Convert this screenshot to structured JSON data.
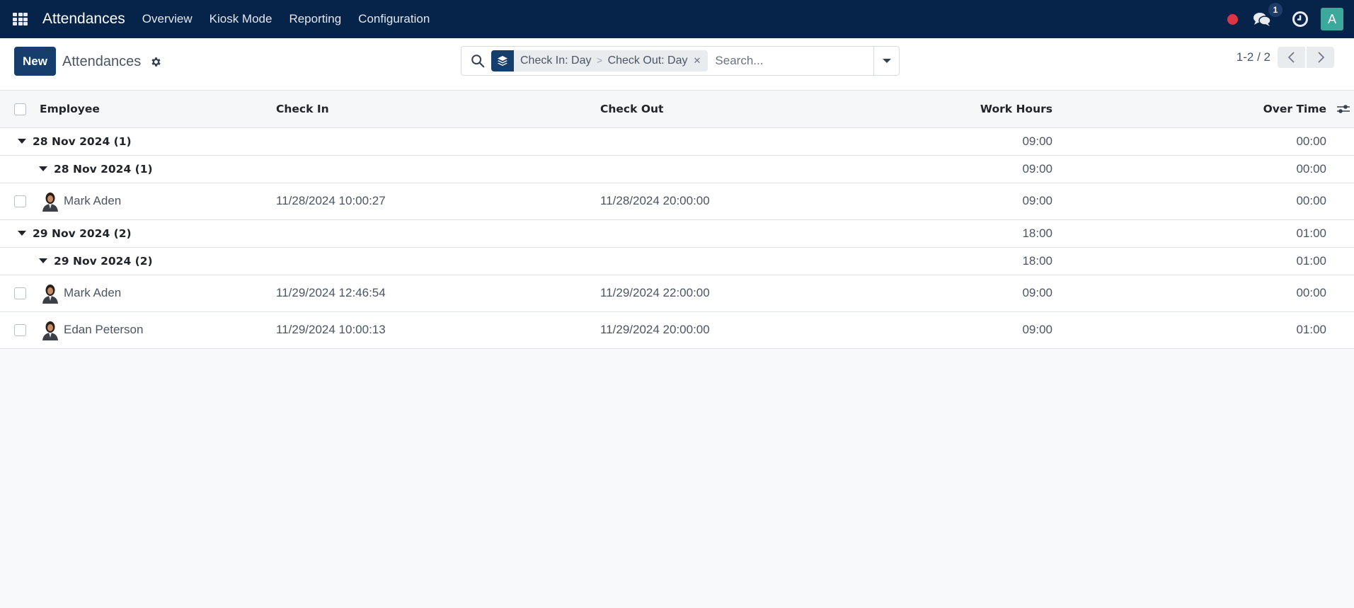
{
  "navbar": {
    "app_title": "Attendances",
    "menu": [
      "Overview",
      "Kiosk Mode",
      "Reporting",
      "Configuration"
    ],
    "icons": [
      "apps-grid-icon",
      "status-dot-icon",
      "chat-icon",
      "clock-icon"
    ],
    "chat_badge": "1",
    "user_initial": "A",
    "colors": {
      "bar": "#06234a",
      "status_dot": "#dc3545",
      "user_avatar": "#3ba99c"
    }
  },
  "control_panel": {
    "new_label": "New",
    "title": "Attendances",
    "search": {
      "facet_parts": [
        "Check In: Day",
        "Check Out: Day"
      ],
      "facet_separator": ">",
      "placeholder": "Search...",
      "value": ""
    },
    "pager": {
      "value": "1-2 / 2"
    }
  },
  "table": {
    "columns": [
      "Employee",
      "Check In",
      "Check Out",
      "Work Hours",
      "Over Time"
    ],
    "groups": [
      {
        "label": "28 Nov 2024 (1)",
        "work_hours": "09:00",
        "over_time": "00:00",
        "subgroups": [
          {
            "label": "28 Nov 2024 (1)",
            "work_hours": "09:00",
            "over_time": "00:00",
            "records": [
              {
                "employee": "Mark Aden",
                "check_in": "11/28/2024 10:00:27",
                "check_out": "11/28/2024 20:00:00",
                "work_hours": "09:00",
                "over_time": "00:00"
              }
            ]
          }
        ]
      },
      {
        "label": "29 Nov 2024 (2)",
        "work_hours": "18:00",
        "over_time": "01:00",
        "subgroups": [
          {
            "label": "29 Nov 2024 (2)",
            "work_hours": "18:00",
            "over_time": "01:00",
            "records": [
              {
                "employee": "Mark Aden",
                "check_in": "11/29/2024 12:46:54",
                "check_out": "11/29/2024 22:00:00",
                "work_hours": "09:00",
                "over_time": "00:00"
              },
              {
                "employee": "Edan Peterson",
                "check_in": "11/29/2024 10:00:13",
                "check_out": "11/29/2024 20:00:00",
                "work_hours": "09:00",
                "over_time": "01:00"
              }
            ]
          }
        ]
      }
    ]
  }
}
